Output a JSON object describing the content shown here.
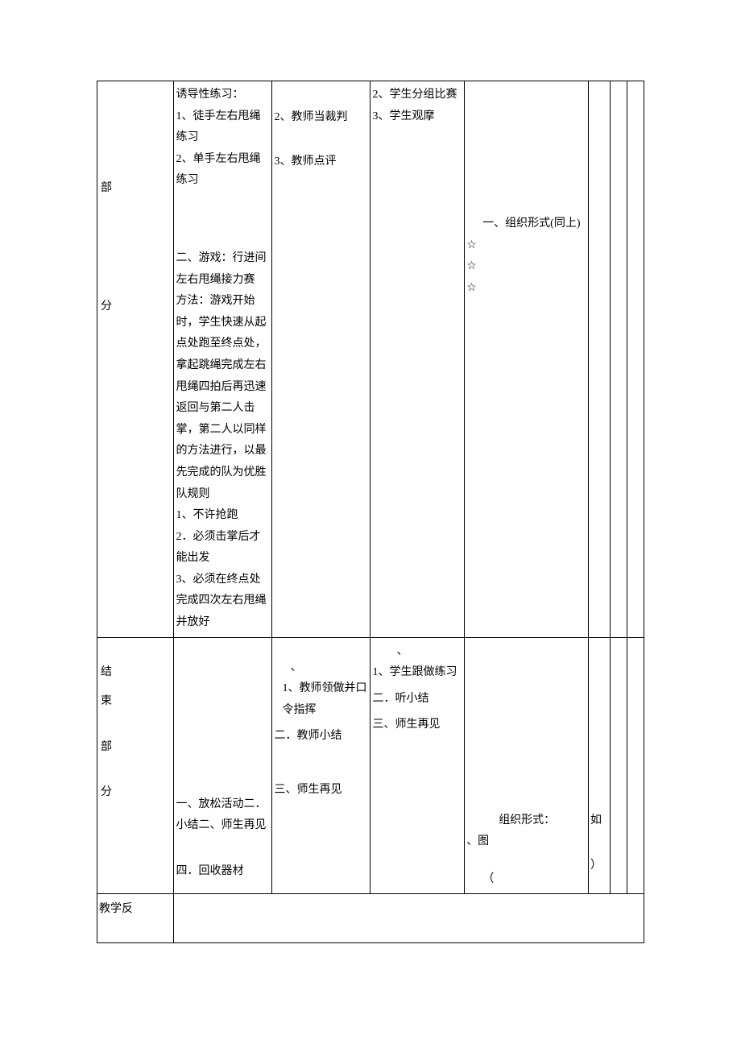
{
  "row1": {
    "label1": "部",
    "label2": "分",
    "col1_a": "诱导性练习：",
    "col1_b": "1、徒手左右甩绳练习",
    "col1_c": "2、单手左右甩绳练习",
    "col1_d": "二、游戏：行进间左右甩绳接力赛",
    "col1_e": "方法：游戏开始时，学生快速从起点处跑至终点处，拿起跳绳完成左右甩绳四拍后再迅速返回与第二人击掌，第二人以同样的方法进行，以最先完成的队为优胜队规则",
    "col1_f": "1、不许抢跑",
    "col1_g": "2．必须击掌后才能出发",
    "col1_h": "3、必须在终点处完成四次左右甩绳并放好",
    "col2_a": "2、教师当裁判",
    "col2_b": "3、教师点评",
    "col3_a": "2、学生分组比赛",
    "col3_b": "3、学生观摩",
    "col4_a": "一、组织形式(同上)",
    "col4_b": "☆",
    "col4_c": "☆",
    "col4_d": "☆"
  },
  "row2": {
    "label1": "结",
    "label2": "束",
    "label3": "部",
    "label4": "分",
    "col1_a": "一、放松活动二．小结二、师生再见",
    "col1_b": "四．回收器材",
    "col2_a": "、",
    "col2_b": "1、教师领做并口令指挥",
    "col2_c": "二．教师小结",
    "col2_d": "三、师生再见",
    "col3_a": "、",
    "col3_b": "1、学生跟做练习",
    "col3_c": "二．听小结",
    "col3_d": "三、师生再见",
    "col4_a": "组织形式：",
    "col4_b": "、图",
    "col4_c": "（",
    "col5_a": "如",
    "col5_b": "）"
  },
  "row3": {
    "label": "教学反"
  }
}
